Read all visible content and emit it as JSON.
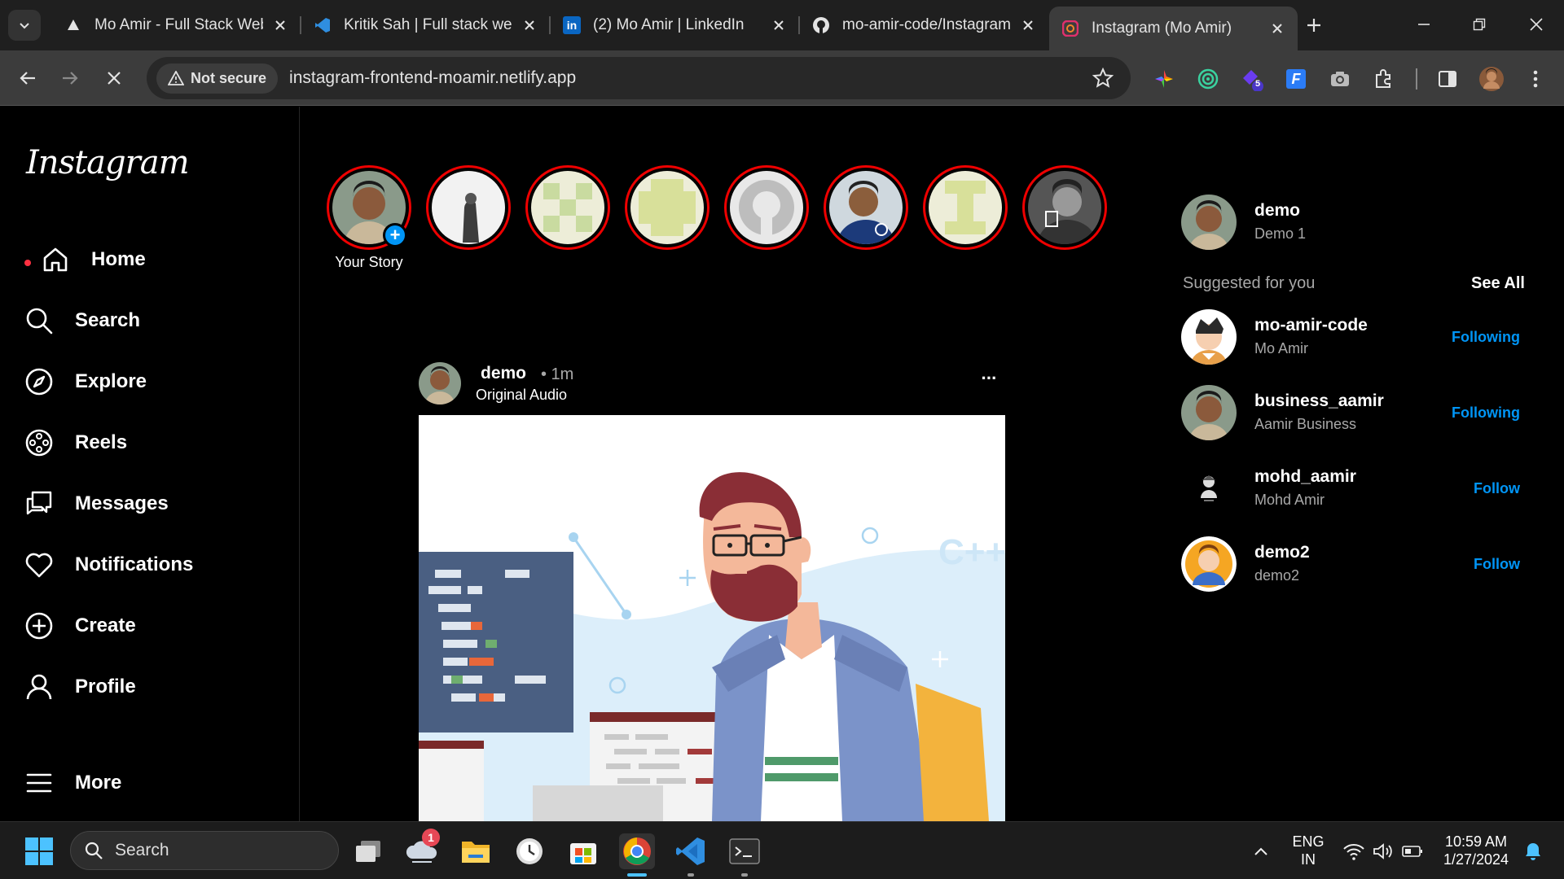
{
  "browser": {
    "tabs": [
      {
        "title": "Mo Amir - Full Stack Web",
        "icon": "netlify-favicon-icon"
      },
      {
        "title": "Kritik Sah | Full stack web",
        "icon": "vscode-favicon-icon"
      },
      {
        "title": "(2) Mo Amir | LinkedIn",
        "icon": "linkedin-favicon-icon"
      },
      {
        "title": "mo-amir-code/Instagram",
        "icon": "github-favicon-icon"
      },
      {
        "title": "Instagram (Mo Amir)",
        "icon": "instagram-favicon-icon",
        "active": true
      }
    ],
    "security_label": "Not secure",
    "url": "instagram-frontend-moamir.netlify.app",
    "extension_badge": "5"
  },
  "sidebar": {
    "logo": "Instagram",
    "items": [
      {
        "label": "Home",
        "icon": "home-icon"
      },
      {
        "label": "Search",
        "icon": "search-icon"
      },
      {
        "label": "Explore",
        "icon": "compass-icon"
      },
      {
        "label": "Reels",
        "icon": "reels-icon"
      },
      {
        "label": "Messages",
        "icon": "messages-icon"
      },
      {
        "label": "Notifications",
        "icon": "heart-icon"
      },
      {
        "label": "Create",
        "icon": "plus-circle-icon"
      },
      {
        "label": "Profile",
        "icon": "user-icon"
      },
      {
        "label": "More",
        "icon": "menu-icon"
      }
    ]
  },
  "stories": {
    "your_story_label": "Your Story",
    "add_symbol": "+"
  },
  "post": {
    "username": "demo",
    "time": "• 1m",
    "subtitle": "Original Audio",
    "more_symbol": "···",
    "image_text": "C++"
  },
  "current_user": {
    "username": "demo",
    "name": "Demo 1"
  },
  "suggestions": {
    "title": "Suggested for you",
    "see_all": "See All",
    "items": [
      {
        "username": "mo-amir-code",
        "name": "Mo Amir",
        "action": "Following"
      },
      {
        "username": "business_aamir",
        "name": "Aamir Business",
        "action": "Following"
      },
      {
        "username": "mohd_aamir",
        "name": "Mohd Amir",
        "action": "Follow"
      },
      {
        "username": "demo2",
        "name": "demo2",
        "action": "Follow"
      }
    ]
  },
  "taskbar": {
    "search_placeholder": "Search",
    "weather_badge": "1",
    "lang_line1": "ENG",
    "lang_line2": "IN",
    "time": "10:59 AM",
    "date": "1/27/2024"
  },
  "colors": {
    "accent_blue": "#0095f6",
    "story_ring": "#e00000",
    "notification_dot": "#ff3040"
  }
}
